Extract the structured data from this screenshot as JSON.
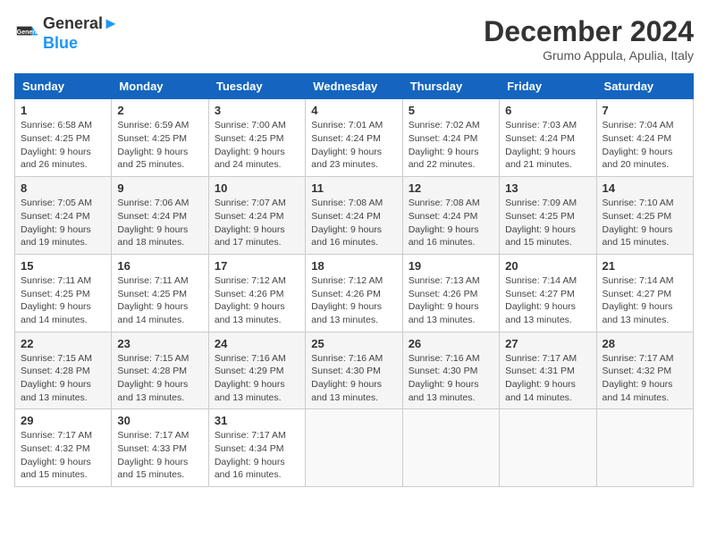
{
  "header": {
    "logo_line1": "General",
    "logo_line2": "Blue",
    "month_title": "December 2024",
    "location": "Grumo Appula, Apulia, Italy"
  },
  "days_of_week": [
    "Sunday",
    "Monday",
    "Tuesday",
    "Wednesday",
    "Thursday",
    "Friday",
    "Saturday"
  ],
  "weeks": [
    [
      {
        "day": 1,
        "sunrise": "6:58 AM",
        "sunset": "4:25 PM",
        "daylight": "9 hours and 26 minutes."
      },
      {
        "day": 2,
        "sunrise": "6:59 AM",
        "sunset": "4:25 PM",
        "daylight": "9 hours and 25 minutes."
      },
      {
        "day": 3,
        "sunrise": "7:00 AM",
        "sunset": "4:25 PM",
        "daylight": "9 hours and 24 minutes."
      },
      {
        "day": 4,
        "sunrise": "7:01 AM",
        "sunset": "4:24 PM",
        "daylight": "9 hours and 23 minutes."
      },
      {
        "day": 5,
        "sunrise": "7:02 AM",
        "sunset": "4:24 PM",
        "daylight": "9 hours and 22 minutes."
      },
      {
        "day": 6,
        "sunrise": "7:03 AM",
        "sunset": "4:24 PM",
        "daylight": "9 hours and 21 minutes."
      },
      {
        "day": 7,
        "sunrise": "7:04 AM",
        "sunset": "4:24 PM",
        "daylight": "9 hours and 20 minutes."
      }
    ],
    [
      {
        "day": 8,
        "sunrise": "7:05 AM",
        "sunset": "4:24 PM",
        "daylight": "9 hours and 19 minutes."
      },
      {
        "day": 9,
        "sunrise": "7:06 AM",
        "sunset": "4:24 PM",
        "daylight": "9 hours and 18 minutes."
      },
      {
        "day": 10,
        "sunrise": "7:07 AM",
        "sunset": "4:24 PM",
        "daylight": "9 hours and 17 minutes."
      },
      {
        "day": 11,
        "sunrise": "7:08 AM",
        "sunset": "4:24 PM",
        "daylight": "9 hours and 16 minutes."
      },
      {
        "day": 12,
        "sunrise": "7:08 AM",
        "sunset": "4:24 PM",
        "daylight": "9 hours and 16 minutes."
      },
      {
        "day": 13,
        "sunrise": "7:09 AM",
        "sunset": "4:25 PM",
        "daylight": "9 hours and 15 minutes."
      },
      {
        "day": 14,
        "sunrise": "7:10 AM",
        "sunset": "4:25 PM",
        "daylight": "9 hours and 15 minutes."
      }
    ],
    [
      {
        "day": 15,
        "sunrise": "7:11 AM",
        "sunset": "4:25 PM",
        "daylight": "9 hours and 14 minutes."
      },
      {
        "day": 16,
        "sunrise": "7:11 AM",
        "sunset": "4:25 PM",
        "daylight": "9 hours and 14 minutes."
      },
      {
        "day": 17,
        "sunrise": "7:12 AM",
        "sunset": "4:26 PM",
        "daylight": "9 hours and 13 minutes."
      },
      {
        "day": 18,
        "sunrise": "7:12 AM",
        "sunset": "4:26 PM",
        "daylight": "9 hours and 13 minutes."
      },
      {
        "day": 19,
        "sunrise": "7:13 AM",
        "sunset": "4:26 PM",
        "daylight": "9 hours and 13 minutes."
      },
      {
        "day": 20,
        "sunrise": "7:14 AM",
        "sunset": "4:27 PM",
        "daylight": "9 hours and 13 minutes."
      },
      {
        "day": 21,
        "sunrise": "7:14 AM",
        "sunset": "4:27 PM",
        "daylight": "9 hours and 13 minutes."
      }
    ],
    [
      {
        "day": 22,
        "sunrise": "7:15 AM",
        "sunset": "4:28 PM",
        "daylight": "9 hours and 13 minutes."
      },
      {
        "day": 23,
        "sunrise": "7:15 AM",
        "sunset": "4:28 PM",
        "daylight": "9 hours and 13 minutes."
      },
      {
        "day": 24,
        "sunrise": "7:16 AM",
        "sunset": "4:29 PM",
        "daylight": "9 hours and 13 minutes."
      },
      {
        "day": 25,
        "sunrise": "7:16 AM",
        "sunset": "4:30 PM",
        "daylight": "9 hours and 13 minutes."
      },
      {
        "day": 26,
        "sunrise": "7:16 AM",
        "sunset": "4:30 PM",
        "daylight": "9 hours and 13 minutes."
      },
      {
        "day": 27,
        "sunrise": "7:17 AM",
        "sunset": "4:31 PM",
        "daylight": "9 hours and 14 minutes."
      },
      {
        "day": 28,
        "sunrise": "7:17 AM",
        "sunset": "4:32 PM",
        "daylight": "9 hours and 14 minutes."
      }
    ],
    [
      {
        "day": 29,
        "sunrise": "7:17 AM",
        "sunset": "4:32 PM",
        "daylight": "9 hours and 15 minutes."
      },
      {
        "day": 30,
        "sunrise": "7:17 AM",
        "sunset": "4:33 PM",
        "daylight": "9 hours and 15 minutes."
      },
      {
        "day": 31,
        "sunrise": "7:17 AM",
        "sunset": "4:34 PM",
        "daylight": "9 hours and 16 minutes."
      },
      null,
      null,
      null,
      null
    ]
  ]
}
